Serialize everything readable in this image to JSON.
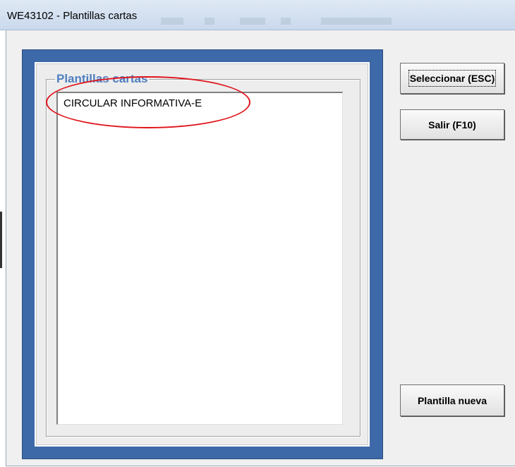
{
  "window": {
    "title": "WE43102 - Plantillas cartas"
  },
  "group": {
    "legend": "Plantillas cartas"
  },
  "list": {
    "items": [
      "CIRCULAR INFORMATIVA-E"
    ]
  },
  "buttons": {
    "select": "Seleccionar (ESC)",
    "exit": "Salir (F10)",
    "new_template": "Plantilla nueva"
  },
  "colors": {
    "frame_blue": "#3d69a8",
    "legend_blue": "#4f7fbf",
    "annotation_red": "#e0141b"
  }
}
